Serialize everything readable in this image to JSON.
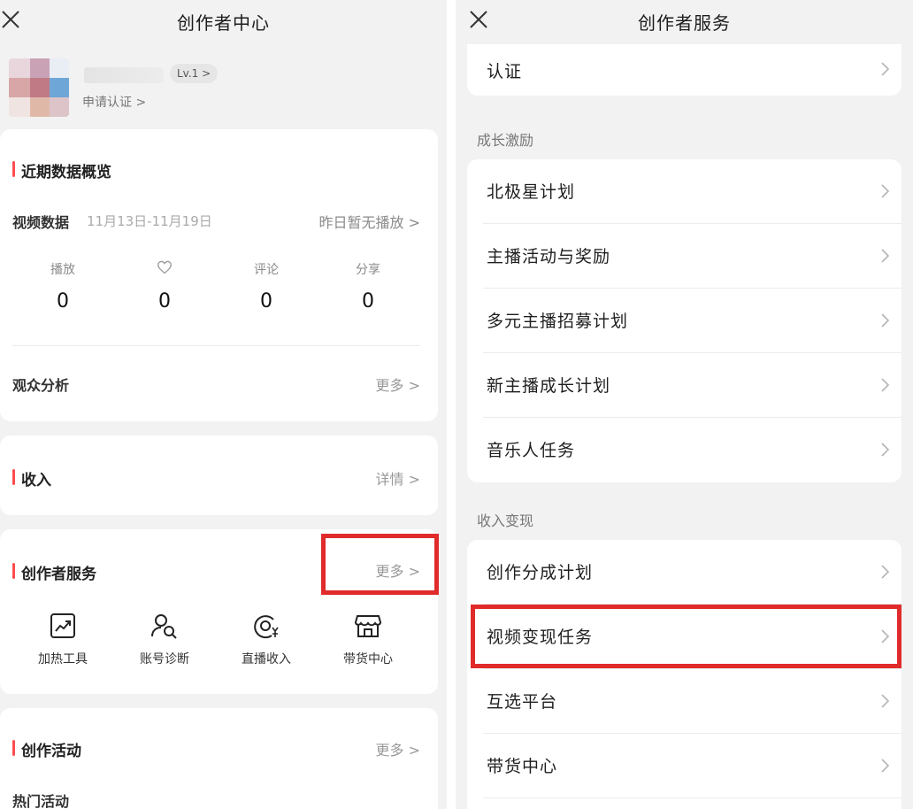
{
  "left": {
    "title": "创作者中心",
    "profile": {
      "level": "Lv.1 >",
      "apply_verify": "申请认证 >"
    },
    "recent": {
      "title": "近期数据概览",
      "video_label": "视频数据",
      "date_range": "11月13日-11月19日",
      "yesterday": "昨日暂无播放 >",
      "stats": [
        {
          "label": "播放",
          "value": "0"
        },
        {
          "label": "",
          "icon": "heart-icon",
          "value": "0"
        },
        {
          "label": "评论",
          "value": "0"
        },
        {
          "label": "分享",
          "value": "0"
        }
      ],
      "audience_label": "观众分析",
      "audience_more": "更多 >"
    },
    "income": {
      "title": "收入",
      "detail": "详情 >"
    },
    "services": {
      "title": "创作者服务",
      "more": "更多 >",
      "items": [
        {
          "label": "加热工具",
          "icon": "trend-chart-icon"
        },
        {
          "label": "账号诊断",
          "icon": "user-search-icon"
        },
        {
          "label": "直播收入",
          "icon": "live-yen-icon"
        },
        {
          "label": "带货中心",
          "icon": "store-icon"
        }
      ]
    },
    "activity": {
      "title": "创作活动",
      "more": "更多 >",
      "hot": "热门活动"
    }
  },
  "right": {
    "title": "创作者服务",
    "top_item": "认证",
    "growth_label": "成长激励",
    "growth_items": [
      "北极星计划",
      "主播活动与奖励",
      "多元主播招募计划",
      "新主播成长计划",
      "音乐人任务"
    ],
    "income_label": "收入变现",
    "income_items": [
      "创作分成计划",
      "视频变现任务",
      "互选平台",
      "带货中心"
    ]
  },
  "colors": {
    "accent_red": "#e02b2b",
    "title_bar": "#ff4d4f",
    "bg": "#f2f2f2"
  }
}
